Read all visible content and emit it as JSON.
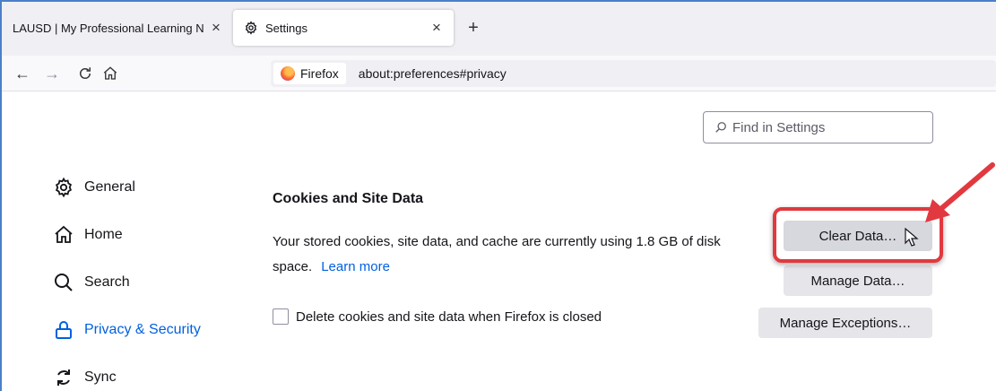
{
  "tabs": [
    {
      "title": "LAUSD | My Professional Learning N",
      "close": "×",
      "active": false,
      "icon": "none"
    },
    {
      "title": "Settings",
      "close": "×",
      "active": true,
      "icon": "gear-icon"
    }
  ],
  "new_tab_label": "+",
  "nav": {
    "back": "←",
    "forward": "→",
    "reload": "C",
    "home_icon": "home-icon"
  },
  "urlbar": {
    "identity_label": "Firefox",
    "url": "about:preferences#privacy"
  },
  "search": {
    "placeholder": "Find in Settings"
  },
  "sidebar": {
    "items": [
      {
        "label": "General",
        "icon": "gear-icon",
        "selected": false
      },
      {
        "label": "Home",
        "icon": "home-icon",
        "selected": false
      },
      {
        "label": "Search",
        "icon": "search-icon",
        "selected": false
      },
      {
        "label": "Privacy & Security",
        "icon": "lock-icon",
        "selected": true
      },
      {
        "label": "Sync",
        "icon": "sync-icon",
        "selected": false
      }
    ]
  },
  "cookies": {
    "title": "Cookies and Site Data",
    "description": "Your stored cookies, site data, and cache are currently using 1.8 GB of disk space.",
    "learn_more": "Learn more",
    "checkbox_label": "Delete cookies and site data when Firefox is closed",
    "checkbox_checked": false,
    "clear_button": "Clear Data…",
    "manage_button": "Manage Data…",
    "exceptions_button": "Manage Exceptions…"
  },
  "colors": {
    "accent": "#0061e0",
    "highlight": "#e1393f"
  }
}
